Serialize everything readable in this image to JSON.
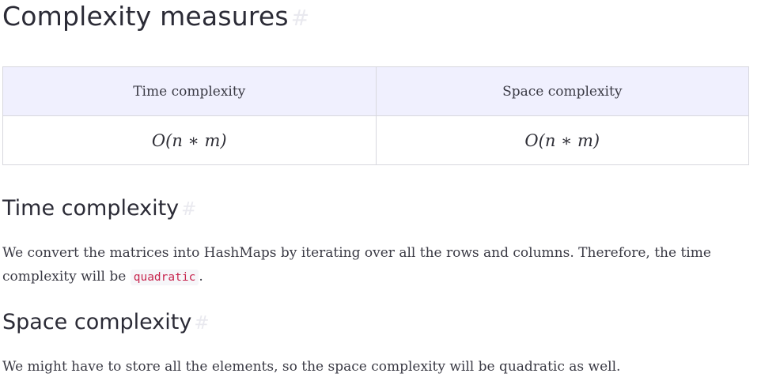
{
  "heading_main": "Complexity measures",
  "anchor_symbol": "#",
  "table": {
    "headers": [
      "Time complexity",
      "Space complexity"
    ],
    "row": [
      "O(n ∗ m)",
      "O(n ∗ m)"
    ]
  },
  "section_time": {
    "heading": "Time complexity",
    "text_before": "We convert the matrices into HashMaps by iterating over all the rows and columns. Therefore, the time complexity will be ",
    "code": "quadratic",
    "text_after": "."
  },
  "section_space": {
    "heading": "Space complexity",
    "text": "We might have to store all the elements, so the space complexity will be quadratic as well."
  }
}
